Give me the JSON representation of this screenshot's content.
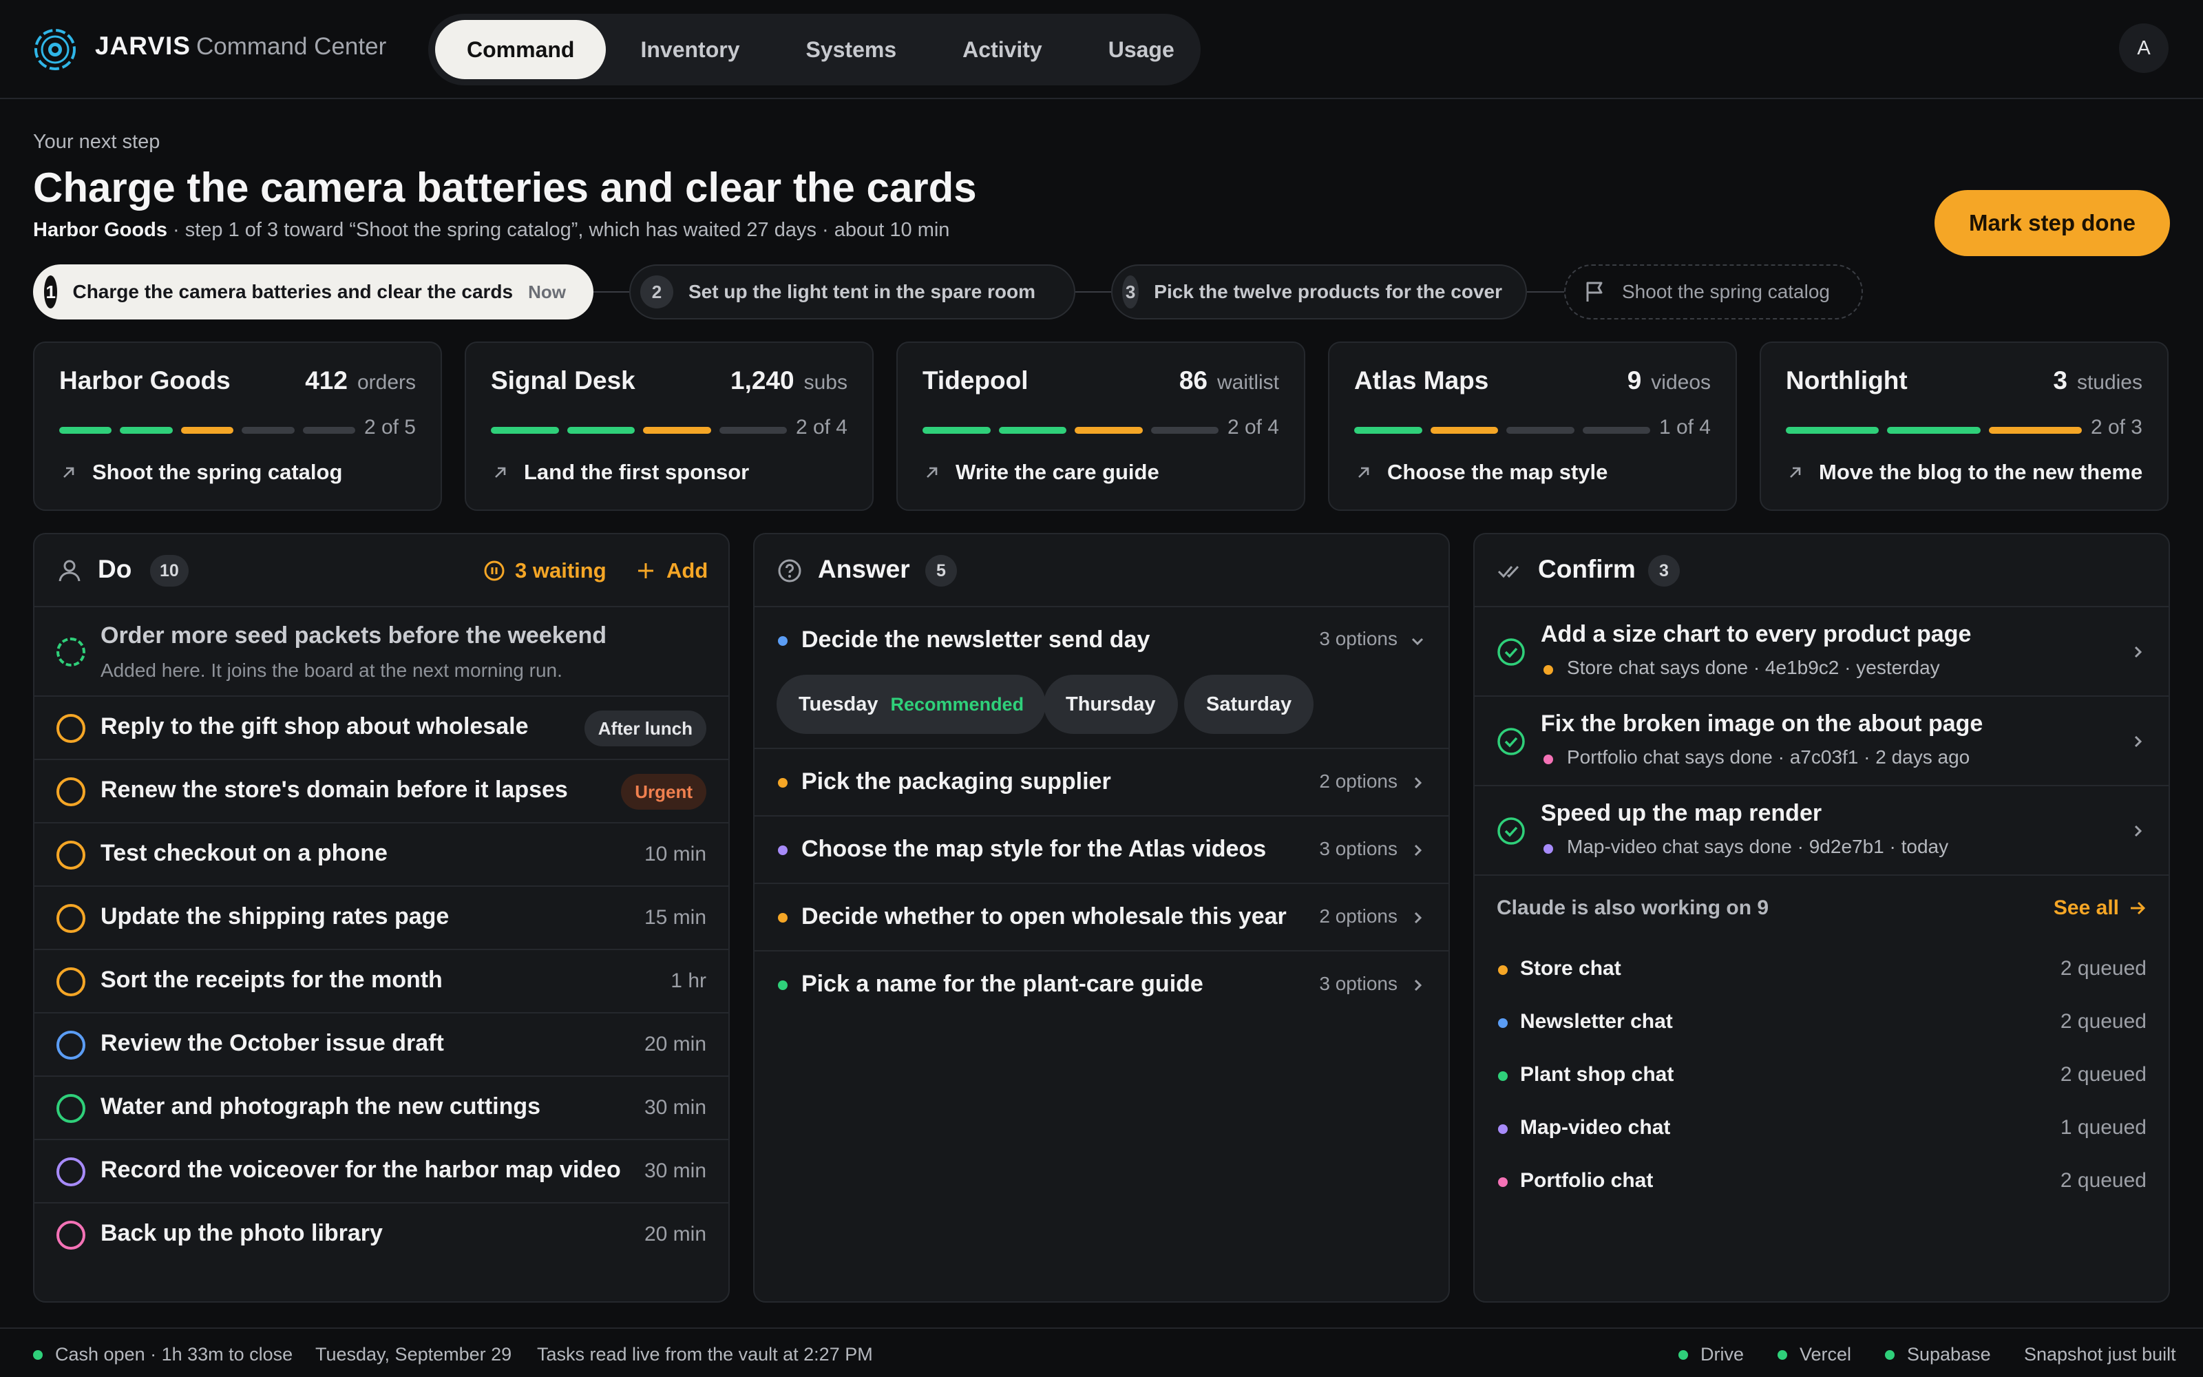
{
  "header": {
    "brand": "JARVIS",
    "brand_sub": "Command Center",
    "tabs": [
      "Command",
      "Inventory",
      "Systems",
      "Activity",
      "Usage"
    ],
    "active_tab": "Command",
    "avatar": "A"
  },
  "next_step": {
    "eyebrow": "Your next step",
    "title": "Charge the camera batteries and clear the cards",
    "project": "Harbor Goods",
    "detail": " · step 1 of 3 toward “Shoot the spring catalog”, which has waited 27 days · about 10 min",
    "button": "Mark step done",
    "steps": [
      {
        "num": "1",
        "label": "Charge the camera batteries and clear the cards",
        "badge": "Now"
      },
      {
        "num": "2",
        "label": "Set up the light tent in the spare room"
      },
      {
        "num": "3",
        "label": "Pick the twelve products for the cover"
      }
    ],
    "goal": "Shoot the spring catalog"
  },
  "projects": [
    {
      "name": "Harbor Goods",
      "count": "412",
      "unit": "orders",
      "progress": "2 of 5",
      "segments": [
        "done",
        "done",
        "current",
        "todo",
        "todo"
      ],
      "goal": "Shoot the spring catalog"
    },
    {
      "name": "Signal Desk",
      "count": "1,240",
      "unit": "subs",
      "progress": "2 of 4",
      "segments": [
        "done",
        "done",
        "current",
        "todo"
      ],
      "goal": "Land the first sponsor"
    },
    {
      "name": "Tidepool",
      "count": "86",
      "unit": "waitlist",
      "progress": "2 of 4",
      "segments": [
        "done",
        "done",
        "current",
        "todo"
      ],
      "goal": "Write the care guide"
    },
    {
      "name": "Atlas Maps",
      "count": "9",
      "unit": "videos",
      "progress": "1 of 4",
      "segments": [
        "done",
        "current",
        "todo",
        "todo"
      ],
      "goal": "Choose the map style"
    },
    {
      "name": "Northlight",
      "count": "3",
      "unit": "studies",
      "progress": "2 of 3",
      "segments": [
        "done",
        "done",
        "current"
      ],
      "goal": "Move the blog to the new theme"
    }
  ],
  "do_panel": {
    "title": "Do",
    "count": "10",
    "waiting": "3 waiting",
    "add": "Add",
    "new_item": {
      "title": "Order more seed packets before the weekend",
      "note": "Added here. It joins the board at the next morning run."
    },
    "tasks": [
      {
        "label": "Reply to the gift shop about wholesale",
        "meta": "After lunch",
        "kind": "tag",
        "color": "#f5a626"
      },
      {
        "label": "Renew the store's domain before it lapses",
        "meta": "Urgent",
        "kind": "urgent",
        "color": "#f5a626"
      },
      {
        "label": "Test checkout on a phone",
        "meta": "10 min",
        "kind": "time",
        "color": "#f5a626"
      },
      {
        "label": "Update the shipping rates page",
        "meta": "15 min",
        "kind": "time",
        "color": "#f5a626"
      },
      {
        "label": "Sort the receipts for the month",
        "meta": "1 hr",
        "kind": "time",
        "color": "#f5a626"
      },
      {
        "label": "Review the October issue draft",
        "meta": "20 min",
        "kind": "time",
        "color": "#5b9df5"
      },
      {
        "label": "Water and photograph the new cuttings",
        "meta": "30 min",
        "kind": "time",
        "color": "#2fd07a"
      },
      {
        "label": "Record the voiceover for the harbor map video",
        "meta": "30 min",
        "kind": "time",
        "color": "#a78bfa"
      },
      {
        "label": "Back up the photo library",
        "meta": "20 min",
        "kind": "time",
        "color": "#f472b6"
      }
    ]
  },
  "answer_panel": {
    "title": "Answer",
    "count": "5",
    "expanded": {
      "label": "Decide the newsletter send day",
      "options_label": "3 options",
      "color": "#5b9df5",
      "options": [
        {
          "label": "Tuesday",
          "note": "Recommended"
        },
        {
          "label": "Thursday"
        },
        {
          "label": "Saturday"
        }
      ]
    },
    "items": [
      {
        "label": "Pick the packaging supplier",
        "options_label": "2 options",
        "color": "#f5a626"
      },
      {
        "label": "Choose the map style for the Atlas videos",
        "options_label": "3 options",
        "color": "#a78bfa"
      },
      {
        "label": "Decide whether to open wholesale this year",
        "options_label": "2 options",
        "color": "#f5a626"
      },
      {
        "label": "Pick a name for the plant-care guide",
        "options_label": "3 options",
        "color": "#2fd07a"
      }
    ]
  },
  "confirm_panel": {
    "title": "Confirm",
    "count": "3",
    "items": [
      {
        "label": "Add a size chart to every product page",
        "meta": "Store chat says done · 4e1b9c2 · yesterday",
        "color": "#f5a626"
      },
      {
        "label": "Fix the broken image on the about page",
        "meta": "Portfolio chat says done · a7c03f1 · 2 days ago",
        "color": "#f472b6"
      },
      {
        "label": "Speed up the map render",
        "meta": "Map-video chat says done · 9d2e7b1 · today",
        "color": "#a78bfa"
      }
    ],
    "working_title": "Claude is also working on 9",
    "see_all": "See all",
    "chats": [
      {
        "name": "Store chat",
        "queued": "2 queued",
        "color": "#f5a626"
      },
      {
        "name": "Newsletter chat",
        "queued": "2 queued",
        "color": "#5b9df5"
      },
      {
        "name": "Plant shop chat",
        "queued": "2 queued",
        "color": "#2fd07a"
      },
      {
        "name": "Map-video chat",
        "queued": "1 queued",
        "color": "#a78bfa"
      },
      {
        "name": "Portfolio chat",
        "queued": "2 queued",
        "color": "#f472b6"
      }
    ]
  },
  "footer": {
    "cash": "Cash open · 1h 33m to close",
    "date": "Tuesday, September 29",
    "vault": "Tasks read live from the vault at 2:27 PM",
    "services": [
      "Drive",
      "Vercel",
      "Supabase"
    ],
    "snapshot": "Snapshot just built"
  },
  "colors": {
    "accent": "#f5a626",
    "done": "#2fd07a",
    "todo": "#3a3d43",
    "panel": "#16181b"
  }
}
